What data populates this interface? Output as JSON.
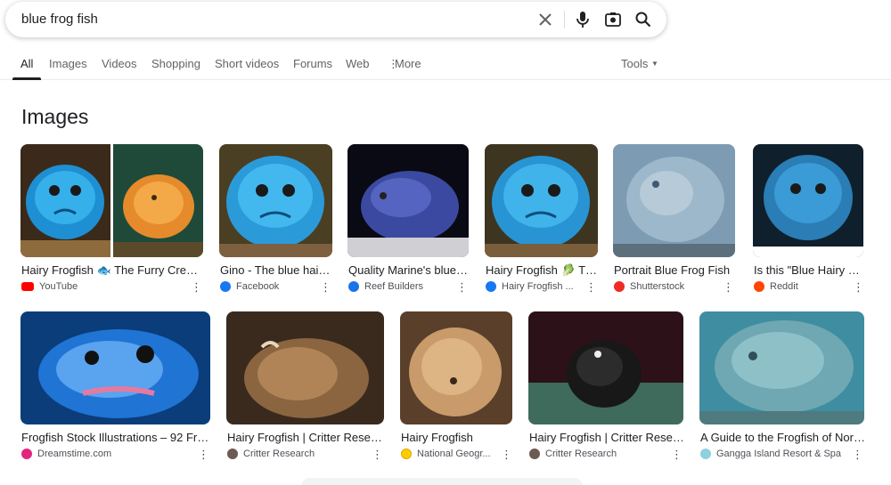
{
  "search": {
    "query": "blue frog fish"
  },
  "tabs": {
    "items": [
      "All",
      "Images",
      "Videos",
      "Shopping",
      "Short videos",
      "Forums",
      "Web"
    ],
    "more_label": "More",
    "tools_label": "Tools"
  },
  "section": {
    "title": "Images"
  },
  "results_row1": [
    {
      "caption": "Hairy Frogfish 🐟 The Furry Creatu...",
      "source": "YouTube",
      "favicon": "youtube-icon",
      "color": "#ff0000"
    },
    {
      "caption": "Gino - The blue hairy...",
      "source": "Facebook",
      "favicon": "facebook-icon",
      "color": "#1877f2"
    },
    {
      "caption": "Quality Marine's blue f...",
      "source": "Reef Builders",
      "favicon": "reef-builders-icon",
      "color": "#1a73e8"
    },
    {
      "caption": "Hairy Frogfish 🥬 Th...",
      "source": "Hairy Frogfish ...",
      "favicon": "facebook-icon",
      "color": "#1877f2"
    },
    {
      "caption": "Portrait Blue Frog Fish",
      "source": "Shutterstock",
      "favicon": "shutterstock-icon",
      "color": "#ee2b24"
    },
    {
      "caption": "Is this \"Blue Hairy Fr...",
      "source": "Reddit",
      "favicon": "reddit-icon",
      "color": "#ff4500"
    }
  ],
  "results_row2": [
    {
      "caption": "Frogfish Stock Illustrations – 92 Frog...",
      "source": "Dreamstime.com",
      "favicon": "dreamstime-icon",
      "color": "#e2267e"
    },
    {
      "caption": "Hairy Frogfish | Critter Resear...",
      "source": "Critter Research",
      "favicon": "critter-research-icon",
      "color": "#6b5b52"
    },
    {
      "caption": "Hairy Frogfish",
      "source": "National Geogr...",
      "favicon": "national-geographic-icon",
      "color": "#ffcc00"
    },
    {
      "caption": "Hairy Frogfish | Critter Resear...",
      "source": "Critter Research",
      "favicon": "critter-research-icon",
      "color": "#6b5b52"
    },
    {
      "caption": "A Guide to the Frogfish of Nort...",
      "source": "Gangga Island Resort & Spa",
      "favicon": "gangga-island-icon",
      "color": "#8ecfe0"
    }
  ]
}
